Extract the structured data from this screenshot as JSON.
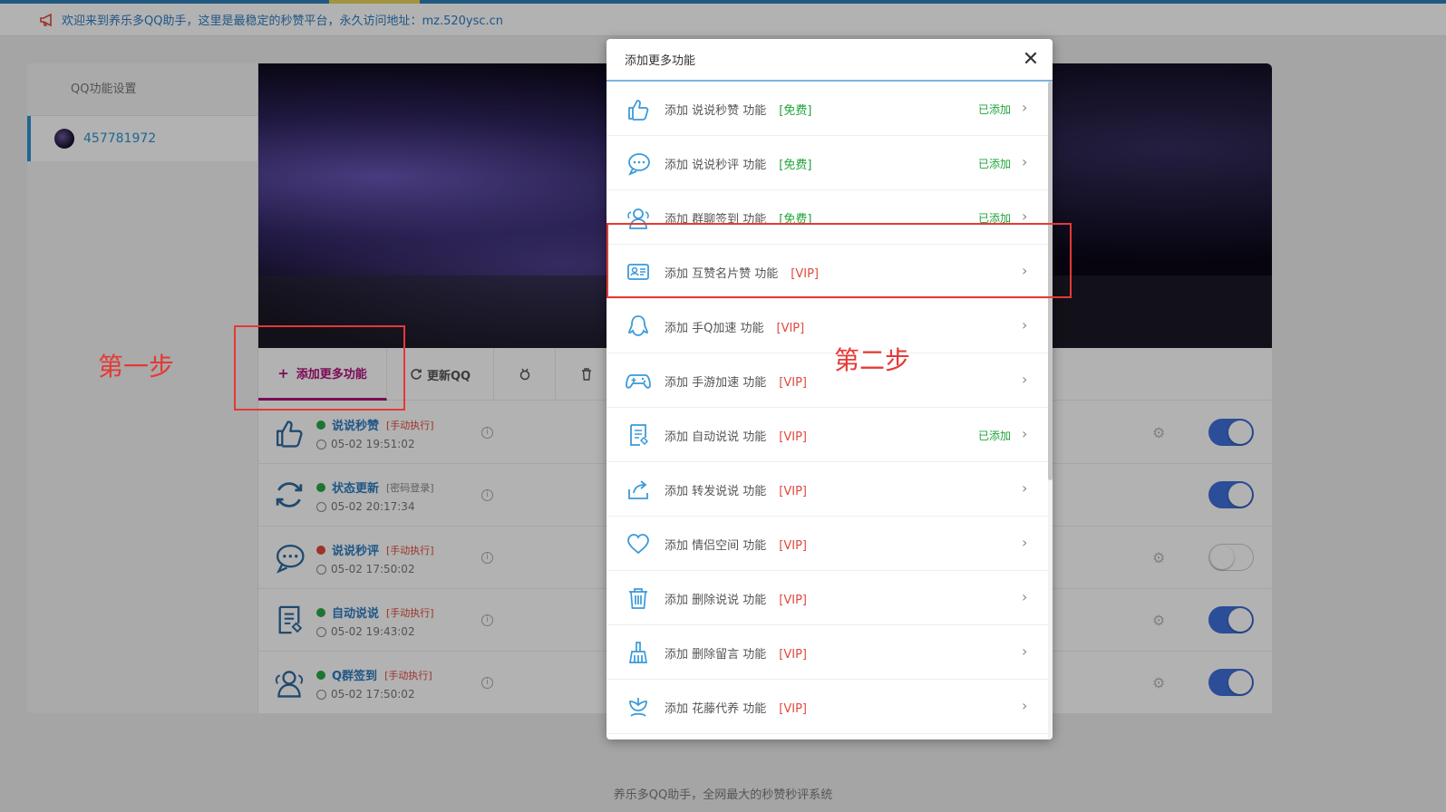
{
  "notice": {
    "text": "欢迎来到养乐多QQ助手，这里是最稳定的秒赞平台，永久访问地址：mz.520ysc.cn"
  },
  "sidebar": {
    "heading": "QQ功能设置",
    "account": "457781972"
  },
  "toolbar": {
    "add_label": "添加更多功能",
    "refresh_label": "更新QQ"
  },
  "tasks": [
    {
      "name": "说说秒赞",
      "status_color": "#2aa845",
      "tag": "[手动执行]",
      "time": "05-02 19:51:02",
      "toggle": true,
      "gear": true,
      "icon": "thumbs-up-icon"
    },
    {
      "name": "状态更新",
      "status_color": "#2aa845",
      "tag": "[密码登录]",
      "time": "05-02 20:17:34",
      "toggle": true,
      "gear": false,
      "icon": "refresh-icon"
    },
    {
      "name": "说说秒评",
      "status_color": "#e0493d",
      "tag": "[手动执行]",
      "time": "05-02 17:50:02",
      "toggle": false,
      "gear": true,
      "icon": "chat-icon"
    },
    {
      "name": "自动说说",
      "status_color": "#2aa845",
      "tag": "[手动执行]",
      "time": "05-02 19:43:02",
      "toggle": true,
      "gear": true,
      "icon": "document-icon"
    },
    {
      "name": "Q群签到",
      "status_color": "#2aa845",
      "tag": "[手动执行]",
      "time": "05-02 17:50:02",
      "toggle": true,
      "gear": true,
      "icon": "group-icon"
    }
  ],
  "modal": {
    "title": "添加更多功能",
    "items": [
      {
        "text": "添加 说说秒赞 功能",
        "tag": "[免费]",
        "type": "free",
        "added": "已添加",
        "icon": "thumbs-up-icon"
      },
      {
        "text": "添加 说说秒评 功能",
        "tag": "[免费]",
        "type": "free",
        "added": "已添加",
        "icon": "chat-icon"
      },
      {
        "text": "添加 群聊签到 功能",
        "tag": "[免费]",
        "type": "free",
        "added": "已添加",
        "icon": "group-icon"
      },
      {
        "text": "添加 互赞名片赞 功能",
        "tag": "[VIP]",
        "type": "vip",
        "added": "",
        "icon": "card-icon"
      },
      {
        "text": "添加 手Q加速 功能",
        "tag": "[VIP]",
        "type": "vip",
        "added": "",
        "icon": "penguin-icon"
      },
      {
        "text": "添加 手游加速 功能",
        "tag": "[VIP]",
        "type": "vip",
        "added": "",
        "icon": "gamepad-icon"
      },
      {
        "text": "添加 自动说说 功能",
        "tag": "[VIP]",
        "type": "vip",
        "added": "已添加",
        "icon": "document-icon"
      },
      {
        "text": "添加 转发说说 功能",
        "tag": "[VIP]",
        "type": "vip",
        "added": "",
        "icon": "share-icon"
      },
      {
        "text": "添加 情侣空间 功能",
        "tag": "[VIP]",
        "type": "vip",
        "added": "",
        "icon": "heart-icon"
      },
      {
        "text": "添加 删除说说 功能",
        "tag": "[VIP]",
        "type": "vip",
        "added": "",
        "icon": "trash-icon"
      },
      {
        "text": "添加 删除留言 功能",
        "tag": "[VIP]",
        "type": "vip",
        "added": "",
        "icon": "broom-icon"
      },
      {
        "text": "添加 花藤代养 功能",
        "tag": "[VIP]",
        "type": "vip",
        "added": "",
        "icon": "flower-icon"
      }
    ]
  },
  "annotations": {
    "step1": "第一步",
    "step2": "第二步"
  },
  "footer": {
    "text": "养乐多QQ助手，全网最大的秒赞秒评系统"
  },
  "colors": {
    "accent": "#2d93cf",
    "brand_magenta": "#b0107a",
    "free_green": "#1ea53a",
    "vip_red": "#e0493d",
    "toggle_on": "#3f6fd8"
  }
}
